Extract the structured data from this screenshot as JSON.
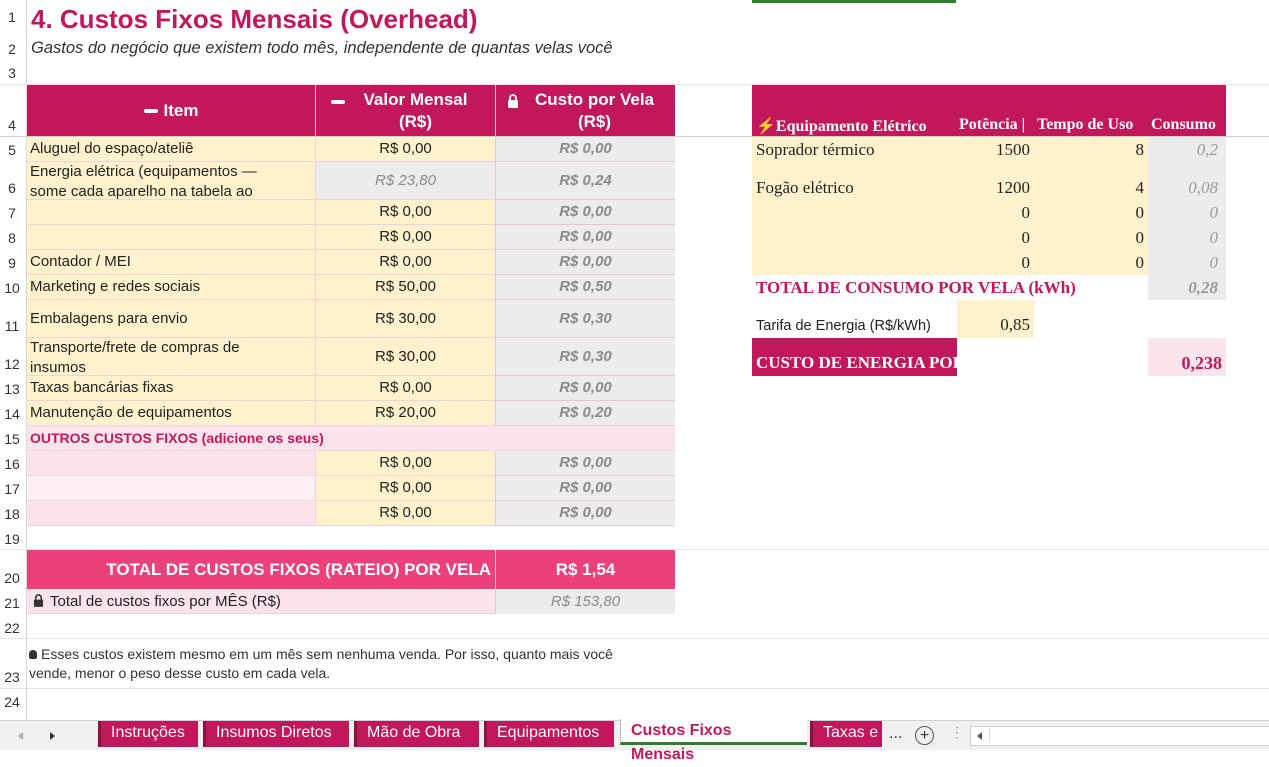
{
  "row_numbers": [
    "1",
    "2",
    "3",
    "4",
    "5",
    "6",
    "7",
    "8",
    "9",
    "10",
    "11",
    "12",
    "13",
    "14",
    "15",
    "16",
    "17",
    "18",
    "19",
    "20",
    "21",
    "22",
    "23",
    "24"
  ],
  "title": "4. Custos Fixos Mensais (Overhead)",
  "subtitle": "Gastos do negócio que existem todo mês, independente de quantas velas você",
  "table": {
    "headers": {
      "item": "Item",
      "valor": "Valor Mensal (R$)",
      "custo": "Custo por Vela (R$)"
    },
    "rows": [
      {
        "item": "Aluguel do espaço/ateliê",
        "valor": "R$ 0,00",
        "custo": "R$ 0,00"
      },
      {
        "item": "Energia elétrica (equipamentos —",
        "item2": "some cada aparelho na tabela ao",
        "valor": "R$ 23,80",
        "custo": "R$ 0,24"
      },
      {
        "item": "",
        "valor": "R$ 0,00",
        "custo": "R$ 0,00"
      },
      {
        "item": "",
        "valor": "R$ 0,00",
        "custo": "R$ 0,00"
      },
      {
        "item": "Contador / MEI",
        "valor": "R$ 0,00",
        "custo": "R$ 0,00"
      },
      {
        "item": "Marketing e redes sociais",
        "valor": "R$ 50,00",
        "custo": "R$ 0,50"
      },
      {
        "item": "Embalagens para envio",
        "valor": "R$ 30,00",
        "custo": "R$ 0,30"
      },
      {
        "item": "Transporte/frete de compras de",
        "item2": "insumos",
        "valor": "R$ 30,00",
        "custo": "R$ 0,30"
      },
      {
        "item": "Taxas bancárias fixas",
        "valor": "R$ 0,00",
        "custo": "R$ 0,00"
      },
      {
        "item": "Manutenção de equipamentos",
        "valor": "R$ 20,00",
        "custo": "R$ 0,20"
      }
    ],
    "outros_label": "OUTROS CUSTOS FIXOS (adicione os seus)",
    "outros_rows": [
      {
        "valor": "R$ 0,00",
        "custo": "R$ 0,00"
      },
      {
        "valor": "R$ 0,00",
        "custo": "R$ 0,00"
      },
      {
        "valor": "R$ 0,00",
        "custo": "R$ 0,00"
      }
    ],
    "total_label": "TOTAL DE CUSTOS FIXOS (RATEIO) POR VELA",
    "total_value": "R$ 1,54",
    "month_label": "Total de custos fixos por MÊS (R$)",
    "month_value": "R$ 153,80",
    "note": "Esses custos existem mesmo em um mês sem nenhuma venda. Por isso, quanto mais você",
    "note2": "vende, menor o peso desse custo em cada vela."
  },
  "equip": {
    "headers": {
      "equip": "Equipamento Elétrico",
      "pot": "Potência |",
      "tempo": "Tempo de Uso",
      "consumo": "Consumo"
    },
    "rows": [
      {
        "name": "Soprador térmico",
        "pot": "1500",
        "tempo": "8",
        "consumo": "0,2"
      },
      {
        "name": "Fogão elétrico",
        "pot": "1200",
        "tempo": "4",
        "consumo": "0,08"
      },
      {
        "name": "",
        "pot": "0",
        "tempo": "0",
        "consumo": "0"
      },
      {
        "name": "",
        "pot": "0",
        "tempo": "0",
        "consumo": "0"
      },
      {
        "name": "",
        "pot": "0",
        "tempo": "0",
        "consumo": "0"
      }
    ],
    "total_label": "TOTAL DE CONSUMO POR VELA (kWh)",
    "total_value": "0,28",
    "tarifa_label": "Tarifa de Energia (R$/kWh)",
    "tarifa_value": "0,85",
    "custo_label": "CUSTO DE ENERGIA POR",
    "custo_value": "0,238"
  },
  "tabs": [
    "Instruções",
    "Insumos Diretos",
    "Mão de Obra",
    "Equipamentos",
    "Custos Fixos Mensais",
    "Taxas e"
  ],
  "tab_more": "...",
  "colors": {
    "accent": "#c2185b",
    "accent_light": "#ec407a",
    "input_fill": "#fff2cc",
    "calc_fill": "#ececec",
    "pink_fill": "#fce4ec"
  }
}
